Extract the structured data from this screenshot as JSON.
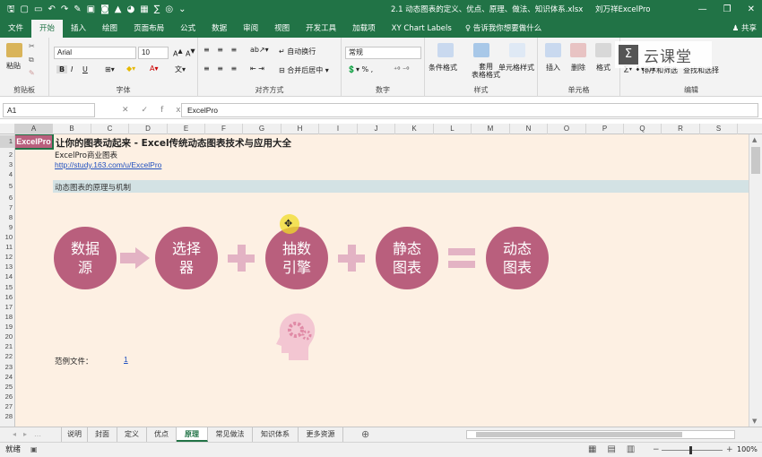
{
  "titlebar": {
    "doc_title": "2.1 动态图表的定义、优点、原理、做法、知识体系.xlsx - Excel",
    "doc_title_short": "2.1 动态图表的定义、优点、原理、做法、知识体系.xlsx",
    "user": "刘万祥ExcelPro",
    "qat_icons": [
      "save-icon",
      "new-icon",
      "open-icon",
      "undo-icon",
      "redo-icon",
      "format-painter-icon",
      "image-icon",
      "camera-icon",
      "shape-icon",
      "chart-icon",
      "table-icon",
      "formula-icon",
      "target-icon",
      "chevron-icon",
      "customize-icon"
    ],
    "win_min": "—",
    "win_restore": "❐",
    "win_close": "✕"
  },
  "tabs": [
    "文件",
    "开始",
    "插入",
    "绘图",
    "页面布局",
    "公式",
    "数据",
    "审阅",
    "视图",
    "开发工具",
    "加载项",
    "XY Chart Labels"
  ],
  "active_tab": "开始",
  "tellme": "告诉我你想要做什么",
  "share": "共享",
  "ribbon": {
    "paste": "粘贴",
    "clipboard": "剪贴板",
    "font_name": "Arial",
    "font_size": "10",
    "font": "字体",
    "wrap": "自动换行",
    "merge": "合并后居中",
    "alignment": "对齐方式",
    "number_format": "常规",
    "number": "数字",
    "cond_format": "条件格式",
    "as_table": "套用\n表格格式",
    "cell_styles": "单元格样式",
    "styles": "样式",
    "insert": "插入",
    "delete": "删除",
    "format": "格式",
    "cells": "单元格",
    "sort_filter": "排序和筛选",
    "find_select": "查找和选择",
    "editing": "编辑",
    "bold": "B",
    "italic": "I",
    "underline": "U"
  },
  "logo_text": "云课堂",
  "formula": {
    "namebox": "A1",
    "fx": "fx",
    "content": "ExcelPro"
  },
  "columns": [
    "A",
    "B",
    "C",
    "D",
    "E",
    "F",
    "G",
    "H",
    "I",
    "J",
    "K",
    "L",
    "M",
    "N",
    "O",
    "P",
    "Q",
    "R",
    "S"
  ],
  "rows": [
    "1",
    "2",
    "3",
    "4",
    "5",
    "6",
    "7",
    "8",
    "9",
    "10",
    "11",
    "12",
    "13",
    "14",
    "15",
    "16",
    "17",
    "18",
    "19",
    "20",
    "21",
    "22",
    "23",
    "24",
    "25",
    "26",
    "27",
    "28"
  ],
  "cells": {
    "a1": "ExcelPro",
    "b1": "让你的图表动起来 - Excel传统动态图表技术与应用大全",
    "b2": "ExcelPro商业图表",
    "b3": "http://study.163.com/u/ExcelPro",
    "b5": "动态图表的原理与机制",
    "b22": "范例文件：",
    "d22": "1"
  },
  "diagram": {
    "steps": [
      "数据源",
      "选择器",
      "抽数引擎",
      "静态图表",
      "动态图表"
    ],
    "step_lines": [
      [
        "数据",
        "源"
      ],
      [
        "选择",
        "器"
      ],
      [
        "抽数",
        "引擎"
      ],
      [
        "静态",
        "图表"
      ],
      [
        "动态",
        "图表"
      ]
    ],
    "operators": [
      "→",
      "+",
      "+",
      "="
    ],
    "accent": "#b95f7d",
    "operator_color": "#e3b3c4"
  },
  "sheet_tabs": [
    "说明",
    "封面",
    "定义",
    "优点",
    "原理",
    "常见做法",
    "知识体系",
    "更多资源"
  ],
  "active_sheet": "原理",
  "status": {
    "ready": "就绪",
    "zoom": "100%"
  },
  "colors": {
    "excel_green": "#217346",
    "sheet_bg": "#fdf0e3",
    "band": "#d3e2e4",
    "a1_fill": "#b95f7d"
  }
}
